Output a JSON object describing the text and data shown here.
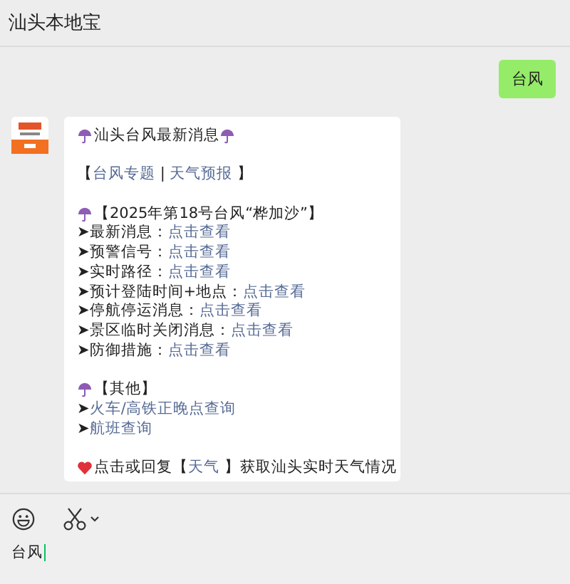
{
  "header": {
    "title": "汕头本地宝"
  },
  "sent_message": {
    "text": "台风"
  },
  "reply": {
    "lines": [
      {
        "kind": "umbrella_title",
        "parts": [
          {
            "text": "汕头台风最新消息"
          }
        ]
      },
      {
        "kind": "blank"
      },
      {
        "kind": "plain",
        "parts": [
          {
            "text": "【"
          },
          {
            "link": "台风专题"
          },
          {
            "text": " | "
          },
          {
            "link": "天气预报"
          },
          {
            "text": " 】"
          }
        ]
      },
      {
        "kind": "blank"
      },
      {
        "kind": "umbrella",
        "parts": [
          {
            "text": "【2025年第18号台风“桦加沙”】"
          }
        ]
      },
      {
        "kind": "plain",
        "parts": [
          {
            "text": "➤最新消息："
          },
          {
            "link": "点击查看"
          }
        ]
      },
      {
        "kind": "plain",
        "parts": [
          {
            "text": "➤预警信号："
          },
          {
            "link": "点击查看"
          }
        ]
      },
      {
        "kind": "plain",
        "parts": [
          {
            "text": "➤实时路径："
          },
          {
            "link": "点击查看"
          }
        ]
      },
      {
        "kind": "plain",
        "parts": [
          {
            "text": "➤预计登陆时间+地点："
          },
          {
            "link": "点击查看"
          }
        ]
      },
      {
        "kind": "plain",
        "parts": [
          {
            "text": "➤停航停运消息："
          },
          {
            "link": "点击查看"
          }
        ]
      },
      {
        "kind": "plain",
        "parts": [
          {
            "text": "➤景区临时关闭消息："
          },
          {
            "link": "点击查看"
          }
        ]
      },
      {
        "kind": "plain",
        "parts": [
          {
            "text": "➤防御措施："
          },
          {
            "link": "点击查看"
          }
        ]
      },
      {
        "kind": "blank"
      },
      {
        "kind": "umbrella",
        "parts": [
          {
            "text": "【其他】"
          }
        ]
      },
      {
        "kind": "plain",
        "parts": [
          {
            "text": "➤"
          },
          {
            "link": "火车/高铁正晚点查询"
          }
        ]
      },
      {
        "kind": "plain",
        "parts": [
          {
            "text": "➤"
          },
          {
            "link": "航班查询"
          }
        ]
      },
      {
        "kind": "blank"
      },
      {
        "kind": "heart",
        "parts": [
          {
            "text": "点击或回复【"
          },
          {
            "link": "天气 "
          },
          {
            "text": "】获取汕头实时天气情况"
          }
        ]
      }
    ]
  },
  "input": {
    "value": "台风"
  }
}
